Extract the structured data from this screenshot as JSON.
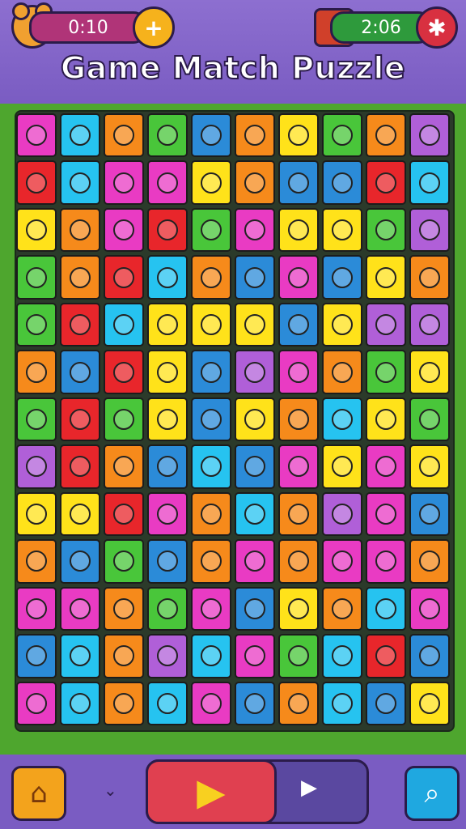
{
  "header": {
    "title": "Game Match Puzzle",
    "score": "0:10",
    "timer": "2:06",
    "add_icon": "plus-icon",
    "settings_icon": "gear-icon",
    "mascot_icon": "bear-icon",
    "cart_icon": "cart-icon"
  },
  "board": {
    "rows": 13,
    "cols": 10,
    "tiles": [
      [
        "#e93bc3",
        "#26c3f0",
        "#f68a1b",
        "#49c63a",
        "#2b8bd8",
        "#f68a1b",
        "#ffe21a",
        "#49c63a",
        "#f68a1b",
        "#b05fd8"
      ],
      [
        "#e8262b",
        "#26c3f0",
        "#e93bc3",
        "#e93bc3",
        "#ffe21a",
        "#f68a1b",
        "#2b8bd8",
        "#2b8bd8",
        "#e8262b",
        "#26c3f0"
      ],
      [
        "#ffe21a",
        "#f68a1b",
        "#e93bc3",
        "#e8262b",
        "#49c63a",
        "#e93bc3",
        "#ffe21a",
        "#ffe21a",
        "#49c63a",
        "#b05fd8"
      ],
      [
        "#49c63a",
        "#f68a1b",
        "#e8262b",
        "#26c3f0",
        "#f68a1b",
        "#2b8bd8",
        "#e93bc3",
        "#2b8bd8",
        "#ffe21a",
        "#f68a1b"
      ],
      [
        "#49c63a",
        "#e8262b",
        "#26c3f0",
        "#ffe21a",
        "#ffe21a",
        "#ffe21a",
        "#2b8bd8",
        "#ffe21a",
        "#b05fd8",
        "#b05fd8"
      ],
      [
        "#f68a1b",
        "#2b8bd8",
        "#e8262b",
        "#ffe21a",
        "#2b8bd8",
        "#b05fd8",
        "#e93bc3",
        "#f68a1b",
        "#49c63a",
        "#ffe21a"
      ],
      [
        "#49c63a",
        "#e8262b",
        "#49c63a",
        "#ffe21a",
        "#2b8bd8",
        "#ffe21a",
        "#f68a1b",
        "#26c3f0",
        "#ffe21a",
        "#49c63a"
      ],
      [
        "#b05fd8",
        "#e8262b",
        "#f68a1b",
        "#2b8bd8",
        "#26c3f0",
        "#2b8bd8",
        "#e93bc3",
        "#ffe21a",
        "#e93bc3",
        "#ffe21a"
      ],
      [
        "#ffe21a",
        "#ffe21a",
        "#e8262b",
        "#e93bc3",
        "#f68a1b",
        "#26c3f0",
        "#f68a1b",
        "#b05fd8",
        "#e93bc3",
        "#2b8bd8"
      ],
      [
        "#f68a1b",
        "#2b8bd8",
        "#49c63a",
        "#2b8bd8",
        "#f68a1b",
        "#e93bc3",
        "#f68a1b",
        "#e93bc3",
        "#e93bc3",
        "#f68a1b"
      ],
      [
        "#e93bc3",
        "#e93bc3",
        "#f68a1b",
        "#49c63a",
        "#e93bc3",
        "#2b8bd8",
        "#ffe21a",
        "#f68a1b",
        "#26c3f0",
        "#e93bc3"
      ],
      [
        "#2b8bd8",
        "#26c3f0",
        "#f68a1b",
        "#b05fd8",
        "#26c3f0",
        "#e93bc3",
        "#49c63a",
        "#26c3f0",
        "#e8262b",
        "#2b8bd8"
      ],
      [
        "#e93bc3",
        "#26c3f0",
        "#f68a1b",
        "#26c3f0",
        "#e93bc3",
        "#2b8bd8",
        "#f68a1b",
        "#26c3f0",
        "#2b8bd8",
        "#ffe21a"
      ]
    ]
  },
  "footer": {
    "home_icon": "home-icon",
    "chevron_icon": "chevron-down-icon",
    "play_icon": "play-icon",
    "next_icon": "next-icon",
    "search_icon": "search-icon"
  }
}
